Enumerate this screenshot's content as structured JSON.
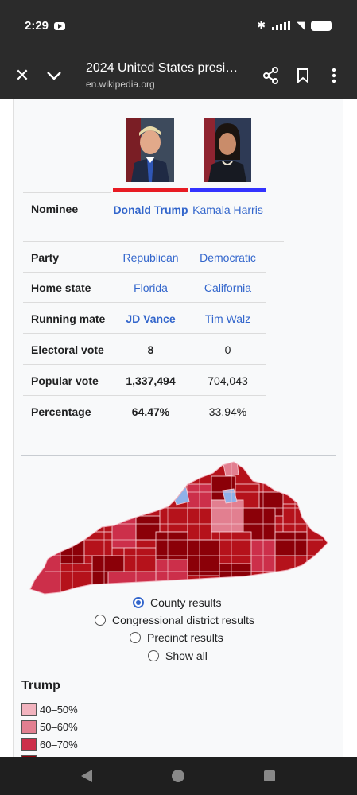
{
  "status": {
    "time": "2:29"
  },
  "toolbar": {
    "title": "2024 United States presi…",
    "url": "en.wikipedia.org"
  },
  "infobox": {
    "rows": [
      {
        "label": "Nominee",
        "trump": "Donald Trump",
        "harris": "Kamala Harris"
      },
      {
        "label": "Party",
        "trump": "Republican",
        "harris": "Democratic"
      },
      {
        "label": "Home state",
        "trump": "Florida",
        "harris": "California"
      },
      {
        "label": "Running mate",
        "trump": "JD Vance",
        "harris": "Tim Walz"
      },
      {
        "label": "Electoral vote",
        "trump": "8",
        "harris": "0"
      },
      {
        "label": "Popular vote",
        "trump": "1,337,494",
        "harris": "704,043"
      },
      {
        "label": "Percentage",
        "trump": "64.47%",
        "harris": "33.94%"
      }
    ],
    "colors": {
      "republican": "#e81b23",
      "democratic": "#3333ff"
    }
  },
  "map": {
    "options": [
      {
        "label": "County results",
        "selected": true
      },
      {
        "label": "Congressional district results",
        "selected": false
      },
      {
        "label": "Precinct results",
        "selected": false
      },
      {
        "label": "Show all",
        "selected": false
      }
    ]
  },
  "legend": {
    "title": "Trump",
    "items": [
      {
        "label": "40–50%",
        "color": "#f2b3be"
      },
      {
        "label": "50–60%",
        "color": "#e27f90"
      },
      {
        "label": "60–70%",
        "color": "#cc2f4a"
      }
    ]
  }
}
